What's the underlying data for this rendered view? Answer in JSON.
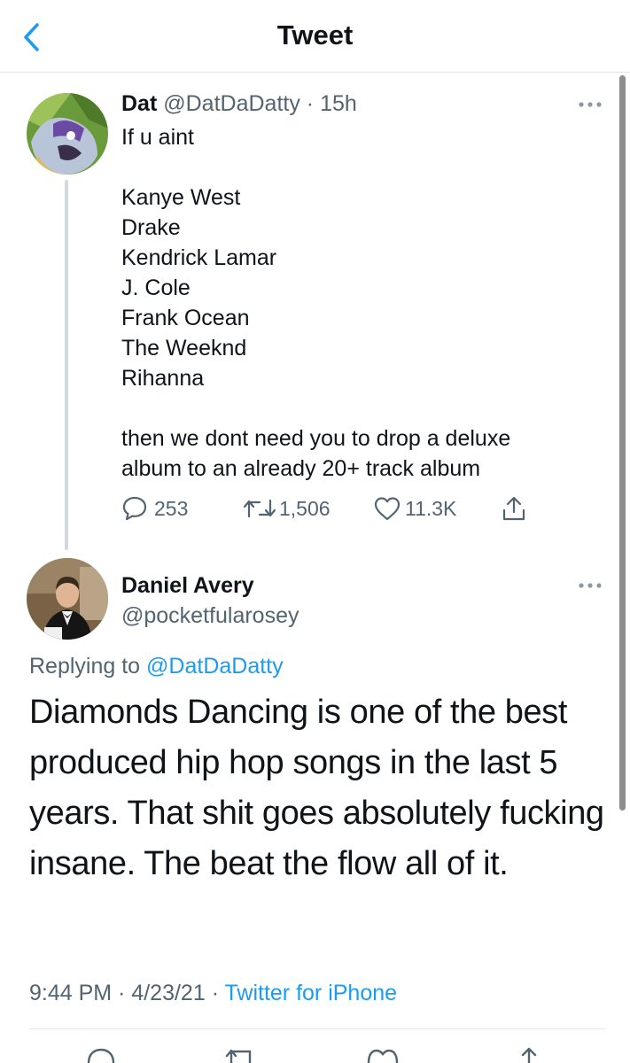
{
  "header": {
    "title": "Tweet"
  },
  "tweet1": {
    "name": "Dat",
    "handle": "@DatDaDatty",
    "time": "15h",
    "body_intro": "If u aint",
    "list": [
      "Kanye West",
      "Drake",
      "Kendrick Lamar",
      "J. Cole",
      "Frank Ocean",
      "The Weeknd",
      "Rihanna"
    ],
    "body_outro_1": "then we dont need you to drop a deluxe",
    "body_outro_2": "album to an already 20+ track album",
    "replies": "253",
    "retweets": "1,506",
    "likes": "11.3K"
  },
  "tweet2": {
    "name": "Daniel Avery",
    "handle": "@pocketfularosey",
    "replying_prefix": "Replying to ",
    "replying_handle": "@DatDaDatty",
    "text": "Diamonds Dancing is one of the best produced hip hop songs in the last 5 years. That shit goes absolutely fucking insane. The beat the flow all of it.",
    "time": "9:44 PM",
    "date": "4/23/21",
    "source": "Twitter for iPhone"
  },
  "icons": {
    "back": "chevron-left-icon",
    "more": "more-horizontal-icon",
    "reply": "reply-icon",
    "retweet": "retweet-icon",
    "like": "heart-icon",
    "share": "share-icon"
  },
  "colors": {
    "accent": "#1d9bf0",
    "secondary_text": "#536471",
    "primary_text": "#0f1419"
  }
}
